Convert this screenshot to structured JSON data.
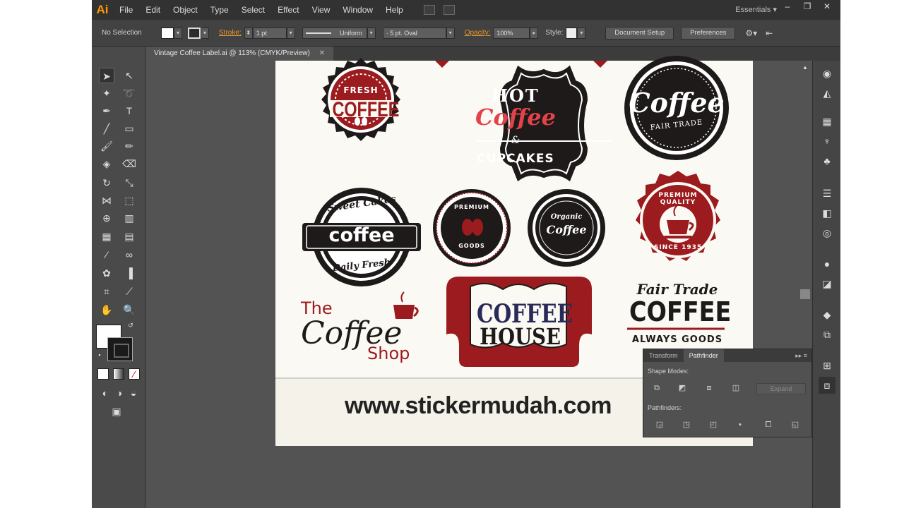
{
  "app": {
    "logo": "Ai"
  },
  "menu": {
    "items": [
      "File",
      "Edit",
      "Object",
      "Type",
      "Select",
      "Effect",
      "View",
      "Window",
      "Help"
    ]
  },
  "workspace": {
    "label": "Essentials"
  },
  "window_buttons": {
    "min": "–",
    "restore": "❐",
    "close": "✕"
  },
  "control": {
    "selection": "No Selection",
    "stroke_label": "Stroke:",
    "stroke_value": "1 pt",
    "profile": "Uniform",
    "brush": "5 pt. Oval",
    "opacity_label": "Opacity:",
    "opacity_value": "100%",
    "style_label": "Style:",
    "document_setup": "Document Setup",
    "preferences": "Preferences"
  },
  "document": {
    "tab_title": "Vintage Coffee Label.ai @ 113% (CMYK/Preview)"
  },
  "artwork": {
    "fresh": "FRESH",
    "coffee1": "COFFEE",
    "hot": "HOT",
    "coffee2": "Coffee",
    "amp": "&",
    "cupcakes": "CUPCAKES",
    "coffee3": "Coffee",
    "fair_trade": "FAIR TRADE",
    "sweet_cakes": "Sweet Cakes",
    "coffee4": "coffee",
    "daily_fresh": "Daily Fresh",
    "premium": "PREMIUM",
    "goods": "GOODS",
    "organic": "Organic",
    "coffee5": "Coffee",
    "premium_quality": "PREMIUM QUALITY",
    "since": "SINCE 1935",
    "the": "The",
    "coffee6": "Coffee",
    "shop": "Shop",
    "coffee7": "COFFEE",
    "house": "HOUSE",
    "fair_trade2": "Fair Trade",
    "coffee8": "COFFEE",
    "always_goods": "ALWAYS GOODS",
    "url": "www.stickermudah.com"
  },
  "pathfinder": {
    "tab_transform": "Transform",
    "tab_pathfinder": "Pathfinder",
    "shape_modes": "Shape Modes:",
    "pathfinders": "Pathfinders:",
    "expand": "Expand"
  },
  "colors": {
    "accent": "#ff9a00",
    "dark_red": "#9b1b1e",
    "label_black": "#1e1a19",
    "cream": "#fbf9f3"
  }
}
